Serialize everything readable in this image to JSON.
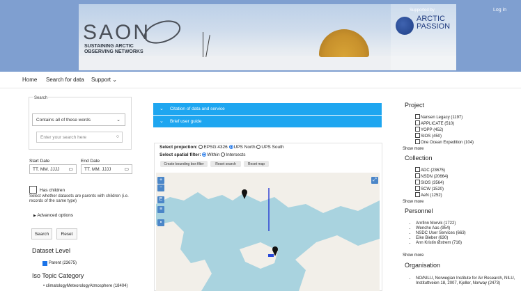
{
  "header": {
    "logo_text": "SAON",
    "logo_subtitle": "SUSTAINING ARCTIC OBSERVING NETWORKS",
    "supported_by": "Supported by",
    "partner_name_line1": "ARCTIC",
    "partner_name_line2": "PASSION",
    "login_label": "Log in"
  },
  "nav": {
    "home": "Home",
    "search": "Search for data",
    "support": "Support",
    "support_chevron": "⌄"
  },
  "search": {
    "legend": "Search",
    "mode_selected": "Contains all of these words",
    "input_placeholder": "Enter your search here",
    "start_date_label": "Start Date",
    "end_date_label": "End Date",
    "start_date_placeholder": "TT. MM. JJJJ",
    "end_date_placeholder": "TT. MM. JJJJ",
    "has_children_label": "Has children",
    "has_children_help": "Select whether datasets are parents with children (i.e. records of the same type)",
    "advanced_options": "Advanced options",
    "search_button": "Search",
    "reset_button": "Reset"
  },
  "dataset_level": {
    "heading": "Dataset Level",
    "items": [
      "Parent (23675)"
    ]
  },
  "iso_topic": {
    "heading": "Iso Topic Category",
    "items": [
      "climatologyMeteorologyAtmosphere (18404)"
    ]
  },
  "accordions": {
    "citation": "Citation of data and service",
    "brief": "Brief user guide"
  },
  "map_panel": {
    "select_projection_label": "Select projection:",
    "projections": [
      "EPSG:4326",
      "UPS North",
      "UPS South"
    ],
    "projection_selected": "UPS North",
    "spatial_filter_label": "Select spatial filter:",
    "filters": [
      "Within",
      "Intersects"
    ],
    "filter_selected": "Within",
    "btn_bbox": "Create bounding box filter",
    "btn_reset_search": "Reset search",
    "btn_reset_map": "Reset map",
    "zoom_in": "+",
    "zoom_out": "−"
  },
  "project": {
    "heading": "Project",
    "items": [
      "Nansen Legacy (1197)",
      "APPLICATE (510)",
      "YOPP (452)",
      "SIOS (450)",
      "One Ocean Expedition (104)"
    ],
    "show_more": "Show more"
  },
  "collection": {
    "heading": "Collection",
    "items": [
      "ADC (23675)",
      "NSDN (20664)",
      "SIOS (3564)",
      "SCW (1520)",
      "AeN (1252)"
    ],
    "show_more": "Show more"
  },
  "personnel": {
    "heading": "Personnel",
    "items": [
      "Arnfinn Morvik (1722)",
      "Wenche Aas (954)",
      "NSDC User Services (663)",
      "Eike Bieber (630)",
      "Ann Kristin Østrem (716)"
    ],
    "show_more": "Show more"
  },
  "organisation": {
    "heading": "Organisation",
    "items": [
      "NO/NILU, Norwegian Institute for Air Research, NILU, Instituttveien 18, 2007, Kjeller, Norway (2473)"
    ]
  },
  "colors": {
    "accent_blue": "#1ea6f0",
    "banner_bg": "#7f9fd0",
    "map_sea": "#a9d3df"
  }
}
